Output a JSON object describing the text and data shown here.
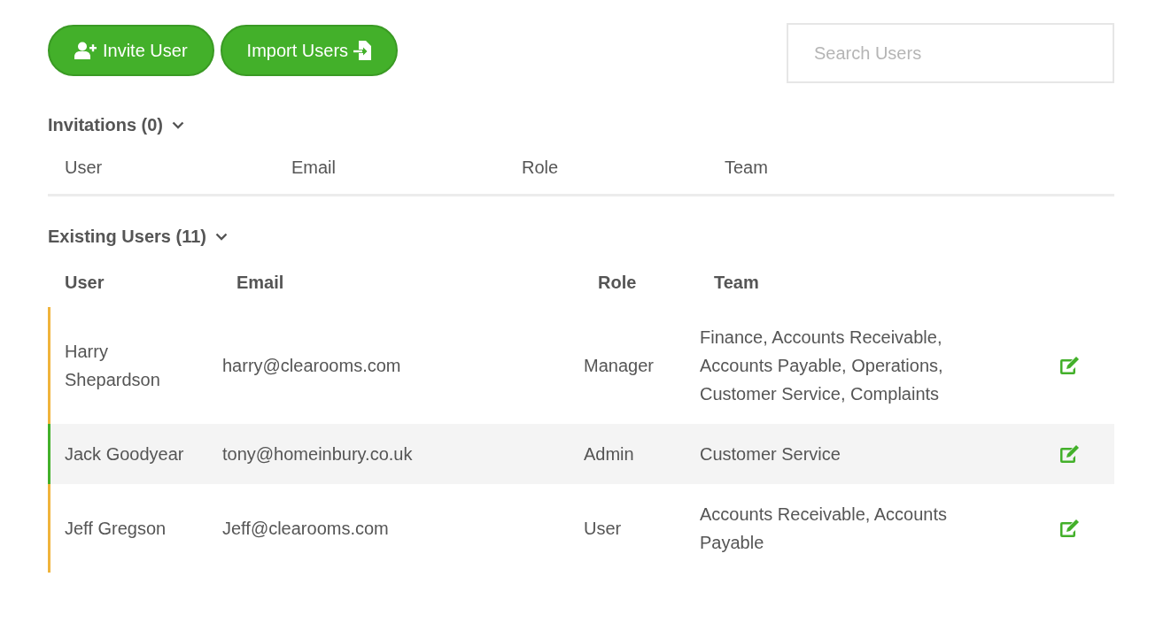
{
  "toolbar": {
    "buttons": [
      {
        "label": "Invite User",
        "kind": "invite"
      },
      {
        "label": "Import Users",
        "kind": "import"
      }
    ]
  },
  "search": {
    "placeholder": "Search Users"
  },
  "invitations": {
    "title": "Invitations (0)",
    "expanded": true,
    "columns": [
      "User",
      "Email",
      "Role",
      "Team"
    ]
  },
  "existing_users": {
    "title": "Existing Users (11)",
    "expanded": true,
    "columns": [
      "User",
      "Email",
      "Role",
      "Team"
    ],
    "rows": [
      {
        "user": "Harry Shepardson",
        "email": "harry@clearooms.com",
        "role": "Manager",
        "team": "Finance, Accounts Receivable, Accounts Payable, Operations, Customer Service, Complaints",
        "color": "#f0b43c"
      },
      {
        "user": "Jack Goodyear",
        "email": "tony@homeinbury.co.uk",
        "role": "Admin",
        "team": "Customer Service",
        "color": "#43b02a"
      },
      {
        "user": "Jeff Gregson",
        "email": "Jeff@clearooms.com",
        "role": "User",
        "team": "Accounts Receivable, Accounts Payable",
        "color": "#f0b43c"
      }
    ]
  }
}
